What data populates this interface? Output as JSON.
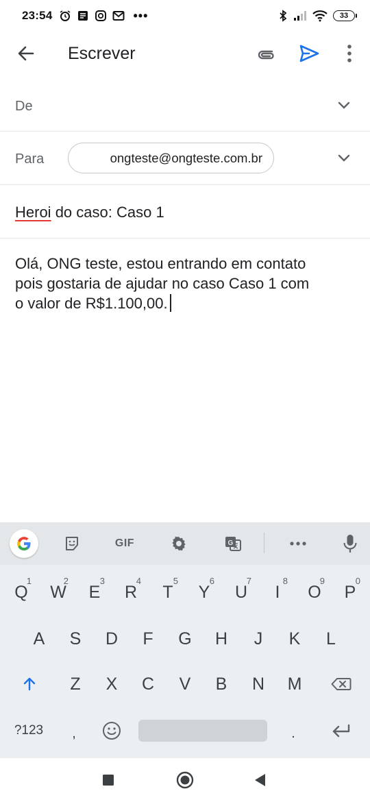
{
  "status_bar": {
    "time": "23:54",
    "dots": "•••",
    "battery": "33",
    "icons": [
      "alarm-icon",
      "message-icon",
      "instagram-icon",
      "gmail-icon",
      "bluetooth-icon",
      "signal-icon",
      "wifi-icon",
      "battery-icon"
    ]
  },
  "app_bar": {
    "title": "Escrever",
    "icons": [
      "back-arrow-icon",
      "attach-icon",
      "send-icon",
      "more-vert-icon"
    ],
    "send_color": "#1a73e8"
  },
  "compose": {
    "from_label": "De",
    "to_label": "Para",
    "to_recipient": "ongteste@ongteste.com.br",
    "subject_misspelled": "Heroi",
    "subject_rest": " do caso: Caso 1",
    "body_lines": [
      "Olá, ONG teste, estou entrando em contato",
      "pois gostaria de ajudar no caso Caso 1 com",
      "o valor de R$1.100,00."
    ]
  },
  "keyboard": {
    "toolbar": {
      "gif_label": "GIF",
      "icons": [
        "google-icon",
        "sticker-icon",
        "gif-icon",
        "settings-gear-icon",
        "translate-icon",
        "more-horiz-icon",
        "mic-icon"
      ]
    },
    "row1": [
      {
        "key": "Q",
        "hint": "1"
      },
      {
        "key": "W",
        "hint": "2"
      },
      {
        "key": "E",
        "hint": "3"
      },
      {
        "key": "R",
        "hint": "4"
      },
      {
        "key": "T",
        "hint": "5"
      },
      {
        "key": "Y",
        "hint": "6"
      },
      {
        "key": "U",
        "hint": "7"
      },
      {
        "key": "I",
        "hint": "8"
      },
      {
        "key": "O",
        "hint": "9"
      },
      {
        "key": "P",
        "hint": "0"
      }
    ],
    "row2": [
      "A",
      "S",
      "D",
      "F",
      "G",
      "H",
      "J",
      "K",
      "L"
    ],
    "row3": [
      "Z",
      "X",
      "C",
      "V",
      "B",
      "N",
      "M"
    ],
    "row4": {
      "symbols": "?123",
      "comma": ",",
      "period": "."
    },
    "accent_color": "#1a73e8"
  },
  "nav_bar": {
    "icons": [
      "recents-square-icon",
      "home-circle-icon",
      "back-triangle-icon"
    ]
  }
}
